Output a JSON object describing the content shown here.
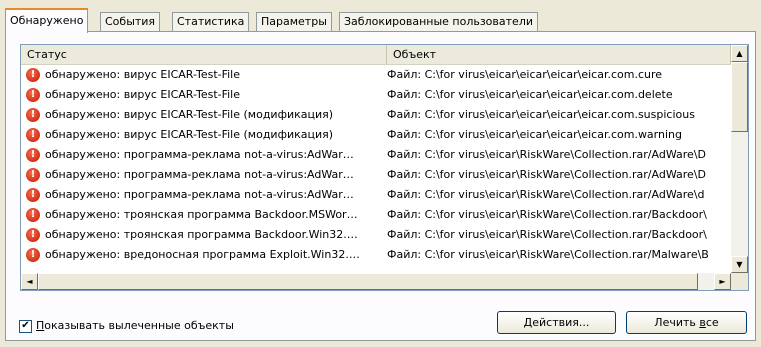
{
  "tabs": [
    "Обнаружено",
    "События",
    "Статистика",
    "Параметры",
    "Заблокированные пользователи"
  ],
  "active_tab": 0,
  "list": {
    "columns": [
      "Статус",
      "Объект"
    ],
    "rows": [
      {
        "status": "обнаружено: вирус EICAR-Test-File",
        "object": "Файл: C:\\for virus\\eicar\\eicar\\eicar\\eicar.com.cure"
      },
      {
        "status": "обнаружено: вирус EICAR-Test-File",
        "object": "Файл: C:\\for virus\\eicar\\eicar\\eicar\\eicar.com.delete"
      },
      {
        "status": "обнаружено: вирус EICAR-Test-File (модификация)",
        "object": "Файл: C:\\for virus\\eicar\\eicar\\eicar\\eicar.com.suspicious"
      },
      {
        "status": "обнаружено: вирус EICAR-Test-File (модификация)",
        "object": "Файл: C:\\for virus\\eicar\\eicar\\eicar\\eicar.com.warning"
      },
      {
        "status": "обнаружено: программа-реклама not-a-virus:AdWar…",
        "object": "Файл: C:\\for virus\\eicar\\RiskWare\\Collection.rar/AdWare\\D"
      },
      {
        "status": "обнаружено: программа-реклама not-a-virus:AdWar…",
        "object": "Файл: C:\\for virus\\eicar\\RiskWare\\Collection.rar/AdWare\\D"
      },
      {
        "status": "обнаружено: программа-реклама not-a-virus:AdWar…",
        "object": "Файл: C:\\for virus\\eicar\\RiskWare\\Collection.rar/AdWare\\d"
      },
      {
        "status": "обнаружено: троянская программа Backdoor.MSWor…",
        "object": "Файл: C:\\for virus\\eicar\\RiskWare\\Collection.rar/Backdoor\\"
      },
      {
        "status": "обнаружено: троянская программа Backdoor.Win32.…",
        "object": "Файл: C:\\for virus\\eicar\\RiskWare\\Collection.rar/Backdoor\\"
      },
      {
        "status": "обнаружено: вредоносная программа Exploit.Win32.…",
        "object": "Файл: C:\\for virus\\eicar\\RiskWare\\Collection.rar/Malware\\B"
      }
    ]
  },
  "show_cured": {
    "label_underlined": "П",
    "label_rest": "оказывать вылеченные объекты",
    "checked": true,
    "mark": "✔"
  },
  "buttons": {
    "actions_underlined": "Д",
    "actions_rest": "ействия...",
    "cure_all_prefix": "Лечить ",
    "cure_all_underlined": "в",
    "cure_all_rest": "се"
  },
  "icons": {
    "alert": "!",
    "arrow_up": "▲",
    "arrow_down": "▼",
    "arrow_left": "◄",
    "arrow_right": "►"
  },
  "colors": {
    "accent_tab": "#e68b2c",
    "alert": "#c21a04",
    "button_border": "#003c74"
  }
}
